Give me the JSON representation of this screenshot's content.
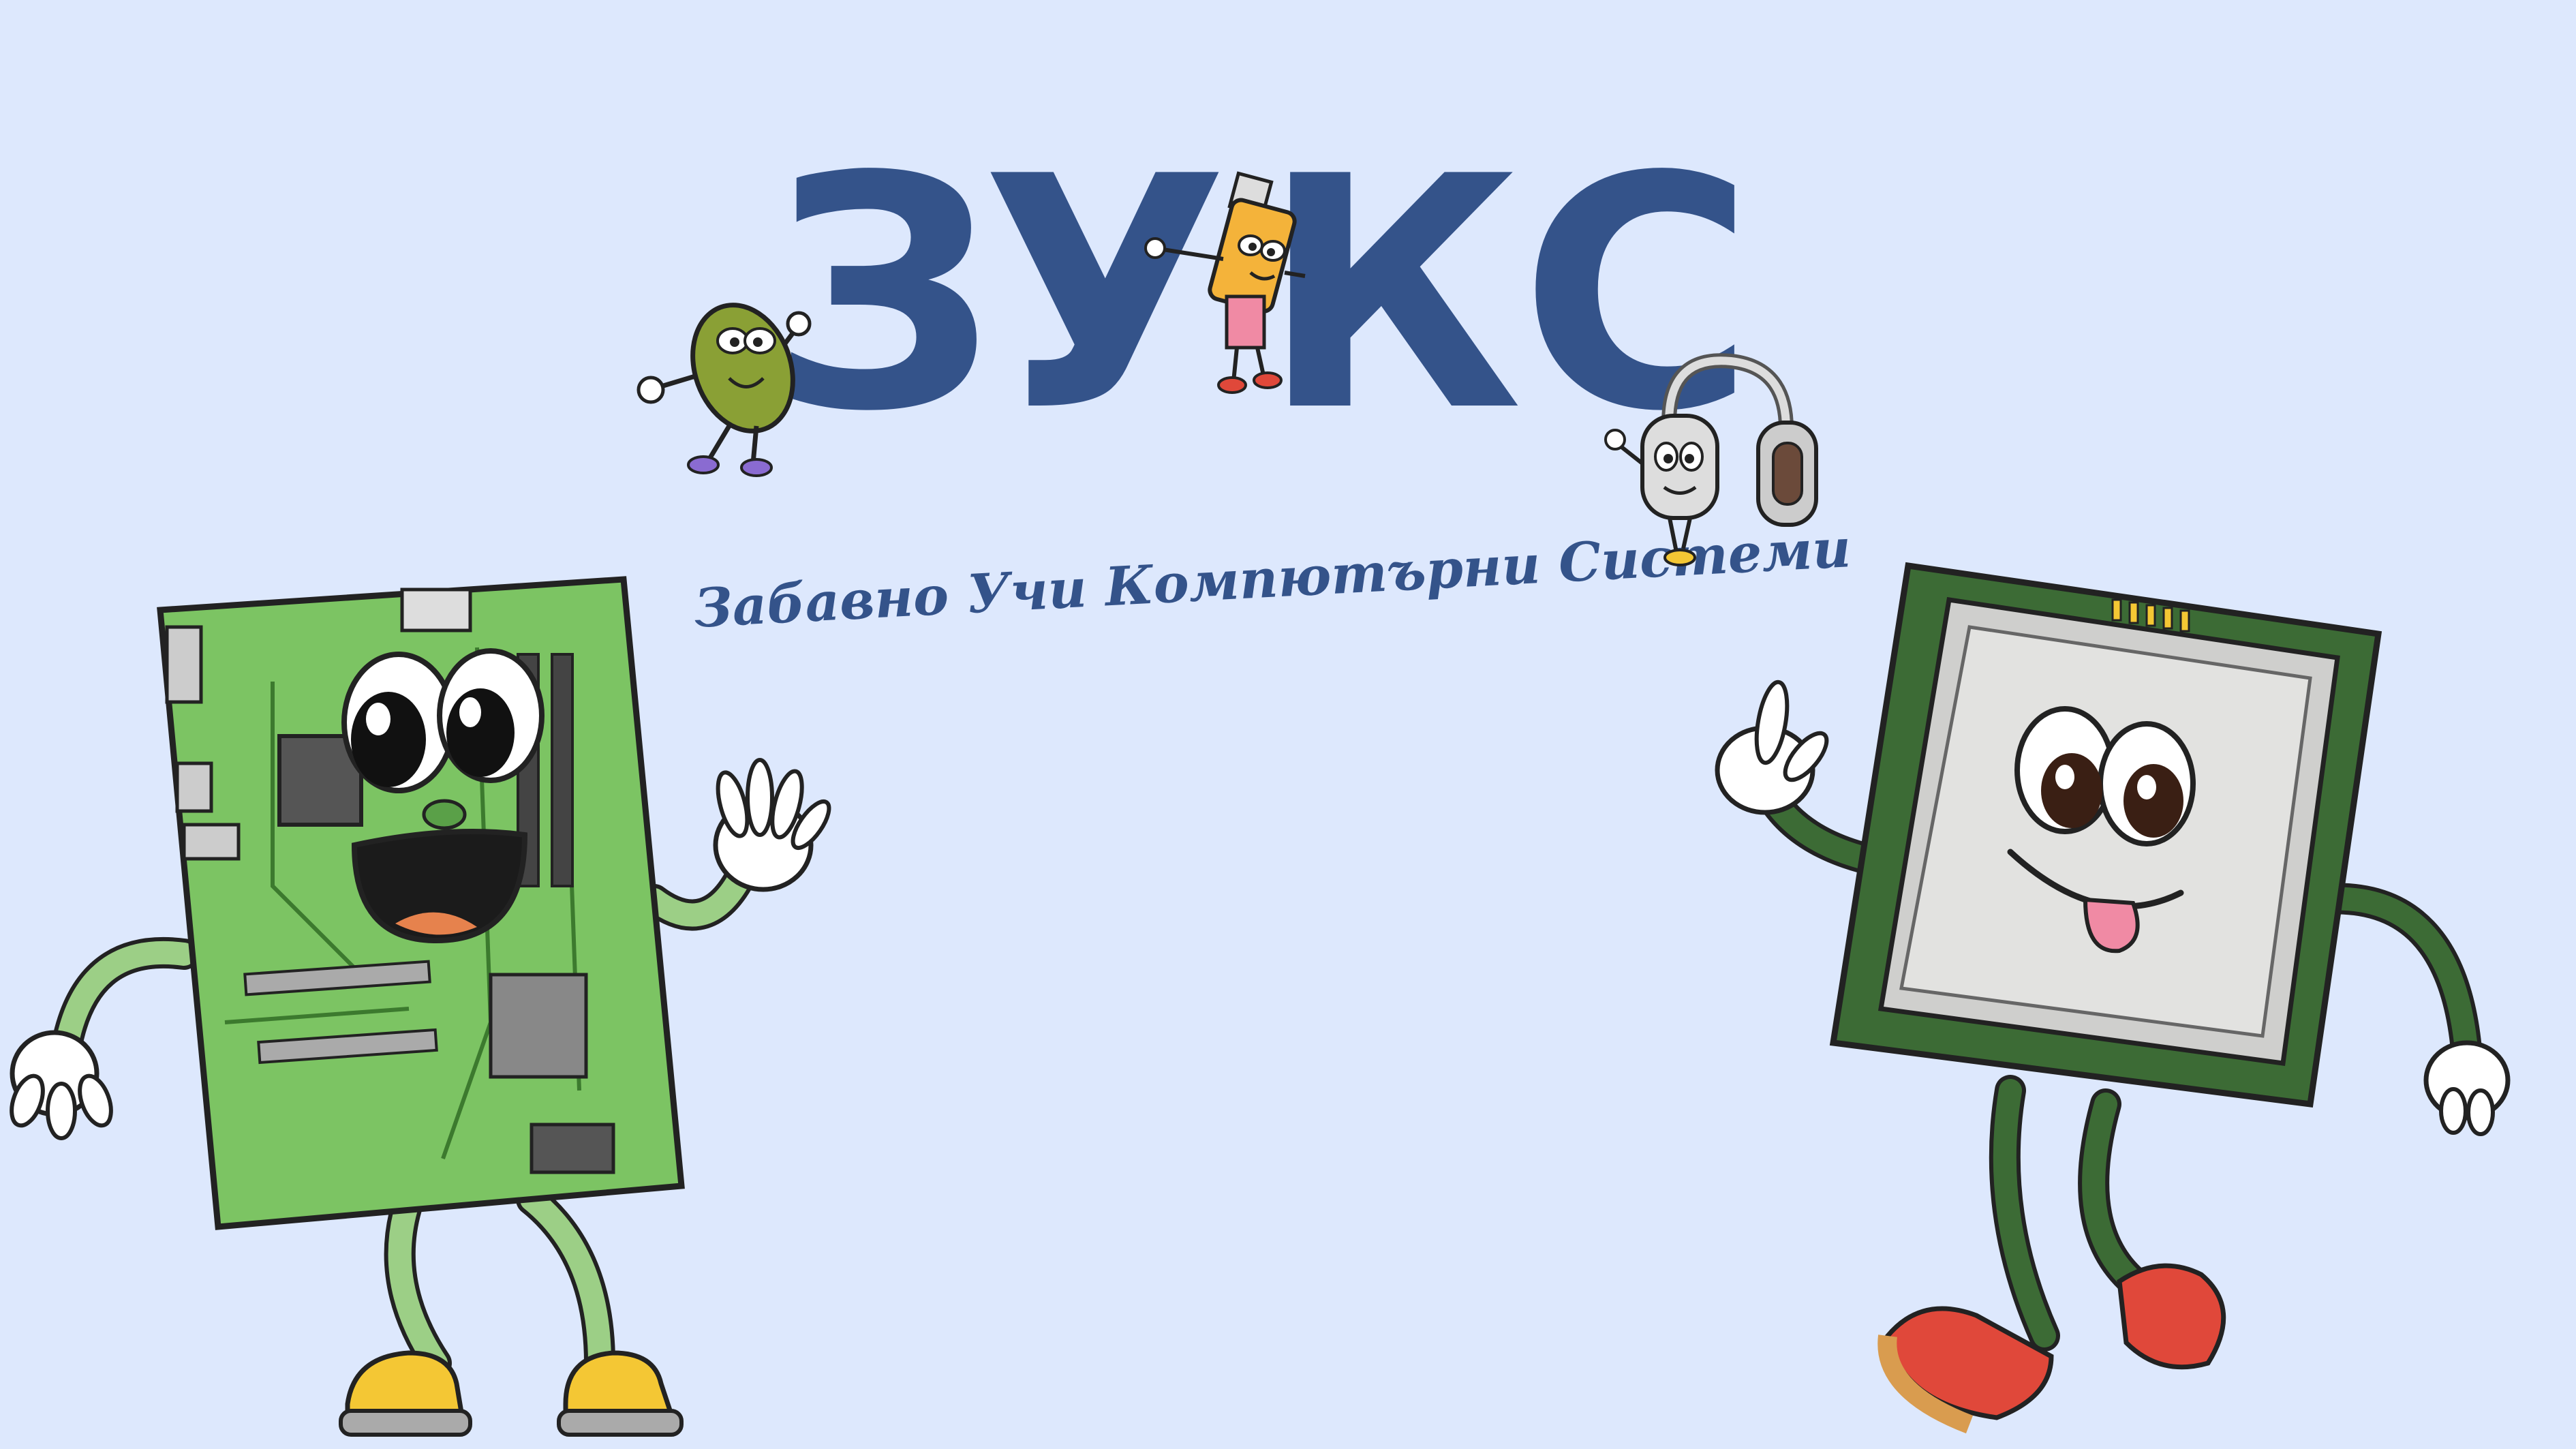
{
  "logo": {
    "title": "ЗУКС",
    "letters": [
      "З",
      "У",
      "К",
      "С"
    ]
  },
  "tagline": "Забавно Учи Компютърни Системи",
  "colors": {
    "background": "#dde8fd",
    "brand": "#34538a",
    "board_green": "#7cc463",
    "cpu_green": "#3c6b35",
    "cpu_lid": "#d7d7d5",
    "shoe_red": "#e0483a",
    "shoe_yellow": "#f4c734"
  },
  "characters": [
    {
      "name": "motherboard-mascot",
      "description": "motherboard character waving"
    },
    {
      "name": "cpu-mascot",
      "description": "CPU character pointing up"
    },
    {
      "name": "mouse-mascot",
      "description": "computer mouse character"
    },
    {
      "name": "usb-mascot",
      "description": "USB flash drive character"
    },
    {
      "name": "headphones-mascot",
      "description": "headphones character"
    }
  ]
}
